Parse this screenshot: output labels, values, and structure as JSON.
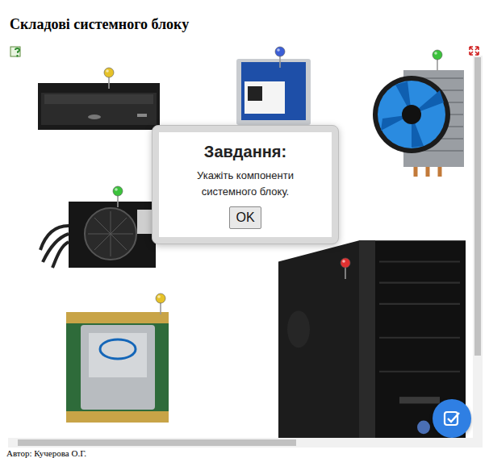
{
  "title": "Складові системного блоку",
  "components": [
    {
      "kind": "optical-drive",
      "color": "#e6c229"
    },
    {
      "kind": "hdd",
      "color": "#3c5fd6"
    },
    {
      "kind": "cooler",
      "color": "#3cc23c"
    },
    {
      "kind": "psu",
      "color": "#3cc23c"
    },
    {
      "kind": "cpu",
      "color": "#e6c229"
    },
    {
      "kind": "case",
      "color": "#e03030"
    }
  ],
  "dialog": {
    "title": "Завдання:",
    "message": "Укажіть компоненти системного блоку.",
    "button": "OK"
  },
  "author": "Автор: Кучерова О.Г."
}
